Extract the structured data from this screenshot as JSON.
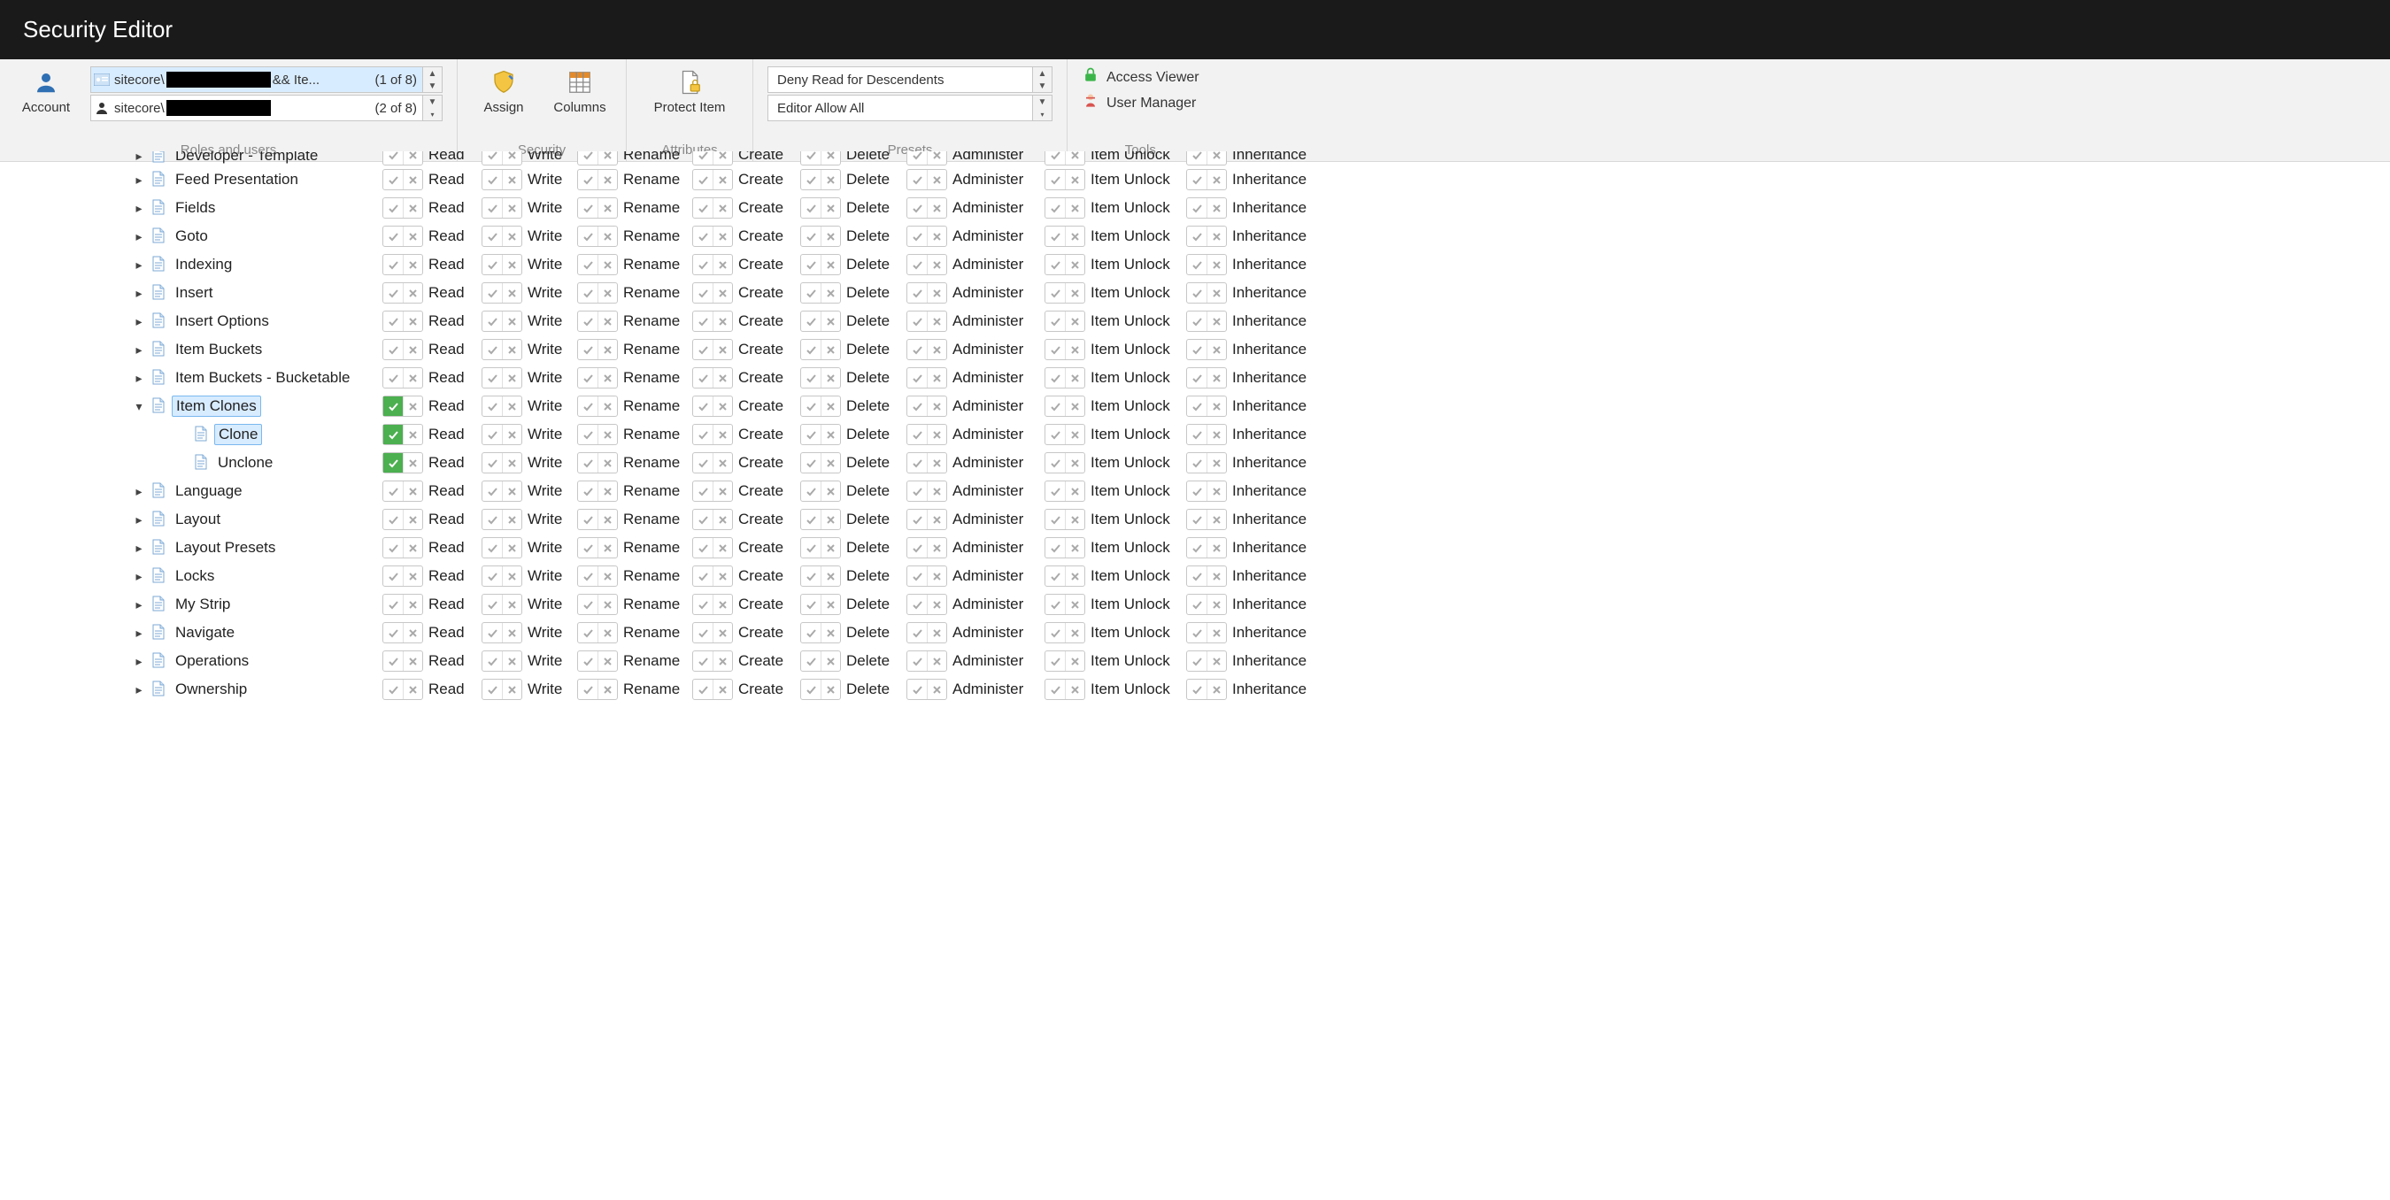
{
  "title": "Security Editor",
  "ribbon": {
    "account": {
      "label": "Account",
      "group": "Roles and users"
    },
    "roles": [
      {
        "prefix": "sitecore\\",
        "suffix": " && Ite... ",
        "count": "(1 of 8)",
        "selected": true,
        "icon": "card"
      },
      {
        "prefix": "sitecore\\",
        "suffix": "",
        "count": "(2 of 8)",
        "selected": false,
        "icon": "user"
      }
    ],
    "security": {
      "assign": "Assign",
      "columns": "Columns",
      "group": "Security"
    },
    "attributes": {
      "protect": "Protect Item",
      "group": "Attributes"
    },
    "presets": {
      "items": [
        "Deny Read for Descendents",
        "Editor Allow All"
      ],
      "group": "Presets"
    },
    "tools": {
      "access": "Access Viewer",
      "user": "User Manager",
      "group": "Tools"
    }
  },
  "perm_labels": {
    "read": "Read",
    "write": "Write",
    "rename": "Rename",
    "create": "Create",
    "delete": "Delete",
    "admin": "Administer",
    "unlock": "Item Unlock",
    "inh": "Inheritance"
  },
  "rows": [
    {
      "label": "Developer - Template",
      "cut": true,
      "caret": "right",
      "indent": 0,
      "hi": false,
      "read_on": false
    },
    {
      "label": "Feed Presentation",
      "caret": "right",
      "indent": 0,
      "hi": false,
      "read_on": false
    },
    {
      "label": "Fields",
      "caret": "right",
      "indent": 0,
      "hi": false,
      "read_on": false
    },
    {
      "label": "Goto",
      "caret": "right",
      "indent": 0,
      "hi": false,
      "read_on": false
    },
    {
      "label": "Indexing",
      "caret": "right",
      "indent": 0,
      "hi": false,
      "read_on": false
    },
    {
      "label": "Insert",
      "caret": "right",
      "indent": 0,
      "hi": false,
      "read_on": false
    },
    {
      "label": "Insert Options",
      "caret": "right",
      "indent": 0,
      "hi": false,
      "read_on": false
    },
    {
      "label": "Item Buckets",
      "caret": "right",
      "indent": 0,
      "hi": false,
      "read_on": false
    },
    {
      "label": "Item Buckets - Bucketable",
      "caret": "right",
      "indent": 0,
      "hi": false,
      "read_on": false
    },
    {
      "label": "Item Clones",
      "caret": "down",
      "indent": 0,
      "hi": true,
      "read_on": true
    },
    {
      "label": "Clone",
      "caret": "none",
      "indent": 1,
      "hi": true,
      "read_on": true
    },
    {
      "label": "Unclone",
      "caret": "none",
      "indent": 1,
      "hi": false,
      "read_on": true
    },
    {
      "label": "Language",
      "caret": "right",
      "indent": 0,
      "hi": false,
      "read_on": false
    },
    {
      "label": "Layout",
      "caret": "right",
      "indent": 0,
      "hi": false,
      "read_on": false
    },
    {
      "label": "Layout Presets",
      "caret": "right",
      "indent": 0,
      "hi": false,
      "read_on": false
    },
    {
      "label": "Locks",
      "caret": "right",
      "indent": 0,
      "hi": false,
      "read_on": false
    },
    {
      "label": "My Strip",
      "caret": "right",
      "indent": 0,
      "hi": false,
      "read_on": false
    },
    {
      "label": "Navigate",
      "caret": "right",
      "indent": 0,
      "hi": false,
      "read_on": false
    },
    {
      "label": "Operations",
      "caret": "right",
      "indent": 0,
      "hi": false,
      "read_on": false
    },
    {
      "label": "Ownership",
      "caret": "right",
      "indent": 0,
      "hi": false,
      "read_on": false
    }
  ]
}
